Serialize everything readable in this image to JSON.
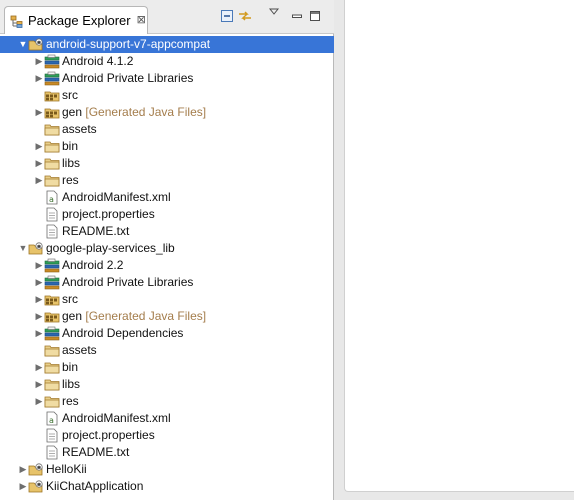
{
  "view": {
    "title": "Package Explorer",
    "close_glyph": "⊠",
    "tools": [
      "collapse-all-icon",
      "link-with-editor-icon",
      "view-menu-icon",
      "minimize-icon",
      "maximize-icon"
    ]
  },
  "tree": [
    {
      "label": "android-support-v7-appcompat",
      "icon": "android-project-icon",
      "depth": 0,
      "expanded": true,
      "selected": true
    },
    {
      "label": "Android 4.1.2",
      "icon": "library-container-icon",
      "depth": 1,
      "expanded": false
    },
    {
      "label": "Android Private Libraries",
      "icon": "library-container-icon",
      "depth": 1,
      "expanded": false
    },
    {
      "label": "src",
      "icon": "source-folder-icon",
      "depth": 1,
      "leaf": true
    },
    {
      "label": "gen",
      "decoration": "[Generated Java Files]",
      "icon": "source-folder-icon",
      "depth": 1,
      "expanded": false
    },
    {
      "label": "assets",
      "icon": "folder-icon",
      "depth": 1,
      "leaf": true
    },
    {
      "label": "bin",
      "icon": "folder-icon",
      "depth": 1,
      "expanded": false
    },
    {
      "label": "libs",
      "icon": "folder-icon",
      "depth": 1,
      "expanded": false
    },
    {
      "label": "res",
      "icon": "folder-icon",
      "depth": 1,
      "expanded": false
    },
    {
      "label": "AndroidManifest.xml",
      "icon": "manifest-file-icon",
      "depth": 1,
      "leaf": true
    },
    {
      "label": "project.properties",
      "icon": "text-file-icon",
      "depth": 1,
      "leaf": true
    },
    {
      "label": "README.txt",
      "icon": "text-file-icon",
      "depth": 1,
      "leaf": true
    },
    {
      "label": "google-play-services_lib",
      "icon": "android-project-icon",
      "depth": 0,
      "expanded": true
    },
    {
      "label": "Android 2.2",
      "icon": "library-container-icon",
      "depth": 1,
      "expanded": false
    },
    {
      "label": "Android Private Libraries",
      "icon": "library-container-icon",
      "depth": 1,
      "expanded": false
    },
    {
      "label": "src",
      "icon": "source-folder-icon",
      "depth": 1,
      "expanded": false
    },
    {
      "label": "gen",
      "decoration": "[Generated Java Files]",
      "icon": "source-folder-icon",
      "depth": 1,
      "expanded": false
    },
    {
      "label": "Android Dependencies",
      "icon": "library-container-icon",
      "depth": 1,
      "expanded": false
    },
    {
      "label": "assets",
      "icon": "folder-icon",
      "depth": 1,
      "leaf": true
    },
    {
      "label": "bin",
      "icon": "folder-icon",
      "depth": 1,
      "expanded": false
    },
    {
      "label": "libs",
      "icon": "folder-icon",
      "depth": 1,
      "expanded": false
    },
    {
      "label": "res",
      "icon": "folder-icon",
      "depth": 1,
      "expanded": false
    },
    {
      "label": "AndroidManifest.xml",
      "icon": "manifest-file-icon",
      "depth": 1,
      "leaf": true
    },
    {
      "label": "project.properties",
      "icon": "text-file-icon",
      "depth": 1,
      "leaf": true
    },
    {
      "label": "README.txt",
      "icon": "text-file-icon",
      "depth": 1,
      "leaf": true
    },
    {
      "label": "HelloKii",
      "icon": "android-project-icon",
      "depth": 0,
      "expanded": false
    },
    {
      "label": "KiiChatApplication",
      "icon": "android-project-icon",
      "depth": 0,
      "expanded": false
    }
  ],
  "colors": {
    "selection": "#3875d7",
    "decoration": "#a47d4c",
    "panel_background": "#ececec"
  }
}
